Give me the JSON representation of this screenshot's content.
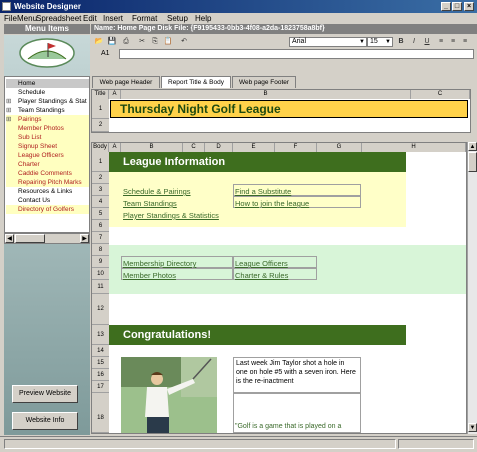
{
  "window": {
    "title": "Website Designer"
  },
  "menu": [
    "File",
    "Menu",
    "Spreadsheet",
    "Edit",
    "Insert",
    "Format",
    "Setup",
    "Help"
  ],
  "left_panel": {
    "header": "Menu Items",
    "items": [
      {
        "label": "Home",
        "pm": "",
        "selected": true,
        "highlight": false
      },
      {
        "label": "Schedule",
        "pm": "",
        "selected": false,
        "highlight": false
      },
      {
        "label": "Player Standings & Stat",
        "pm": "⊞",
        "selected": false,
        "highlight": false
      },
      {
        "label": "Team Standings",
        "pm": "⊞",
        "selected": false,
        "highlight": false
      },
      {
        "label": "Pairings",
        "pm": "⊞",
        "selected": false,
        "highlight": true
      },
      {
        "label": "Member Photos",
        "pm": "",
        "selected": false,
        "highlight": true
      },
      {
        "label": "Sub List",
        "pm": "",
        "selected": false,
        "highlight": true
      },
      {
        "label": "Signup Sheet",
        "pm": "",
        "selected": false,
        "highlight": true
      },
      {
        "label": "League Officers",
        "pm": "",
        "selected": false,
        "highlight": true
      },
      {
        "label": "Charter",
        "pm": "",
        "selected": false,
        "highlight": true
      },
      {
        "label": "Caddie Comments",
        "pm": "",
        "selected": false,
        "highlight": true
      },
      {
        "label": "Repairing Pitch Marks",
        "pm": "",
        "selected": false,
        "highlight": true
      },
      {
        "label": "Resources & Links",
        "pm": "",
        "selected": false,
        "highlight": false
      },
      {
        "label": "Contact Us",
        "pm": "",
        "selected": false,
        "highlight": false
      },
      {
        "label": "Directory of Golfers",
        "pm": "",
        "selected": false,
        "highlight": true
      }
    ],
    "preview_button": "Preview Website",
    "info_button": "Website Info"
  },
  "name_bar": "Name: Home Page   Disk File: {F9195433-0bb3-4f08-a2da-1823758a8bf}",
  "toolbar": {
    "font": "Arial",
    "size": "15",
    "bold": "B",
    "italic": "I",
    "underline": "U",
    "cell_ref": "A1"
  },
  "tabs": [
    "Web page Header",
    "Report Title & Body",
    "Web page Footer"
  ],
  "title_grid": {
    "corner": "Title",
    "col_a": "A",
    "col_b": "B",
    "col_c": "C",
    "rows": [
      "1",
      "2"
    ],
    "title_text": "Thursday Night Golf League"
  },
  "body_grid": {
    "corner": "Body",
    "cols": [
      "A",
      "B",
      "C",
      "D",
      "E",
      "F",
      "G",
      "H"
    ],
    "rows": [
      "1",
      "2",
      "3",
      "4",
      "5",
      "6",
      "7",
      "8",
      "9",
      "10",
      "11",
      "12",
      "13",
      "14",
      "15",
      "16",
      "17",
      "18"
    ],
    "league_info": "League Information",
    "links_left": [
      "Schedule & Pairings",
      "Team Standings",
      "Player Standings & Statistics"
    ],
    "links_right": [
      "Find a Substitute",
      "How to join the league"
    ],
    "links2_left": [
      "Membership Directory",
      "Member Photos"
    ],
    "links2_right": [
      "League Officers",
      "Charter & Rules"
    ],
    "congrats": "Congratulations!",
    "story": "Last week Jim Taylor shot a hole in one on hole #5 with a seven iron. Here is the re-inactment",
    "quote": "\"Golf is a game that is played on a"
  },
  "colors": {
    "band": "#3e6e1e",
    "yellow": "#ffffc8",
    "green_bg": "#d8f5d8",
    "link": "#3a6a2a",
    "title_bg": "#ffd24a"
  }
}
